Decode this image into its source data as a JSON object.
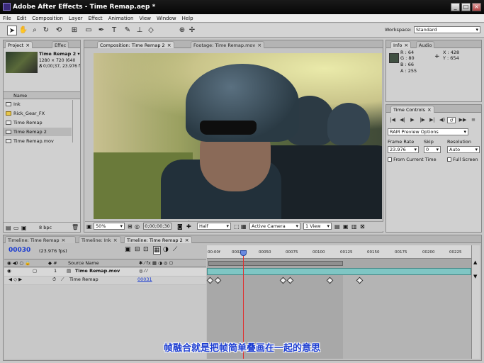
{
  "window": {
    "title": "Adobe After Effects - Time Remap.aep *",
    "buttons": [
      "_",
      "□",
      "×"
    ]
  },
  "menu": [
    "File",
    "Edit",
    "Composition",
    "Layer",
    "Effect",
    "Animation",
    "View",
    "Window",
    "Help"
  ],
  "toolbar": {
    "tool_icons": [
      "selection-tool",
      "hand-tool",
      "zoom-tool",
      "rotate-tool",
      "orbit-tool",
      "pan-behind-tool",
      "rectangle-mask-tool",
      "pen-tool",
      "text-tool",
      "brush-tool",
      "clone-stamp-tool",
      "eraser-tool",
      "puppet-tool"
    ],
    "workspace_label": "Workspace:",
    "workspace_value": "Standard"
  },
  "project": {
    "tabs": [
      "Project",
      "Effec"
    ],
    "item_name": "Time Remap 2 ▾",
    "item_info_1": "1280 × 720 (640 ×",
    "item_info_2": "Δ 0;00;37, 23.976 f",
    "column_name": "Name",
    "items": [
      {
        "name": "Ink",
        "icon": "comp"
      },
      {
        "name": "Rick_Gear_FX",
        "icon": "folder"
      },
      {
        "name": "Time Remap",
        "icon": "comp"
      },
      {
        "name": "Time Remap 2",
        "icon": "comp"
      },
      {
        "name": "Time Remap.mov",
        "icon": "footage"
      }
    ],
    "bpc": "8 bpc"
  },
  "viewer": {
    "tabs": [
      "Composition: Time Remap 2",
      "Footage: Time Remap.mov"
    ],
    "zoom": "50%",
    "timecode": "0;00;00;30",
    "resolution": "Half",
    "camera": "Active Camera",
    "views": "1 View"
  },
  "info": {
    "tabs": [
      "Info",
      "Audio"
    ],
    "r": "R : 64",
    "g": "G : 80",
    "b": "B : 66",
    "a": "A : 255",
    "x": "X : 428",
    "y": "Y : 654"
  },
  "time_controls": {
    "tab": "Time Controls",
    "ram_options": "RAM Preview Options",
    "frame_rate_label": "Frame Rate",
    "frame_rate": "23.976",
    "skip_label": "Skip",
    "skip": "0",
    "resolution_label": "Resolution",
    "resolution": "Auto",
    "from_current": "From Current Time",
    "full_screen": "Full Screen"
  },
  "timeline": {
    "tabs": [
      "Timeline: Time Remap",
      "Timeline: Ink",
      "Timeline: Time Remap 2"
    ],
    "timecode": "00030",
    "fps": "(23.976 fps)",
    "source_name_col": "Source Name",
    "layer_number": "1",
    "layer_name": "Time Remap.mov",
    "prop_name": "Time Remap",
    "prop_value": "00031",
    "ruler": [
      "00:00f",
      "00025",
      "00050",
      "00075",
      "00100",
      "00125",
      "00150",
      "00175",
      "00200",
      "00225"
    ]
  },
  "subtitle": "帧融合就是把帧简单叠画在一起的意思",
  "colors": {
    "accent_blue": "#1a3bd0",
    "titlebar": "#0a0a0a",
    "teal_bar": "#7fc6c4",
    "playhead": "#e03030"
  }
}
